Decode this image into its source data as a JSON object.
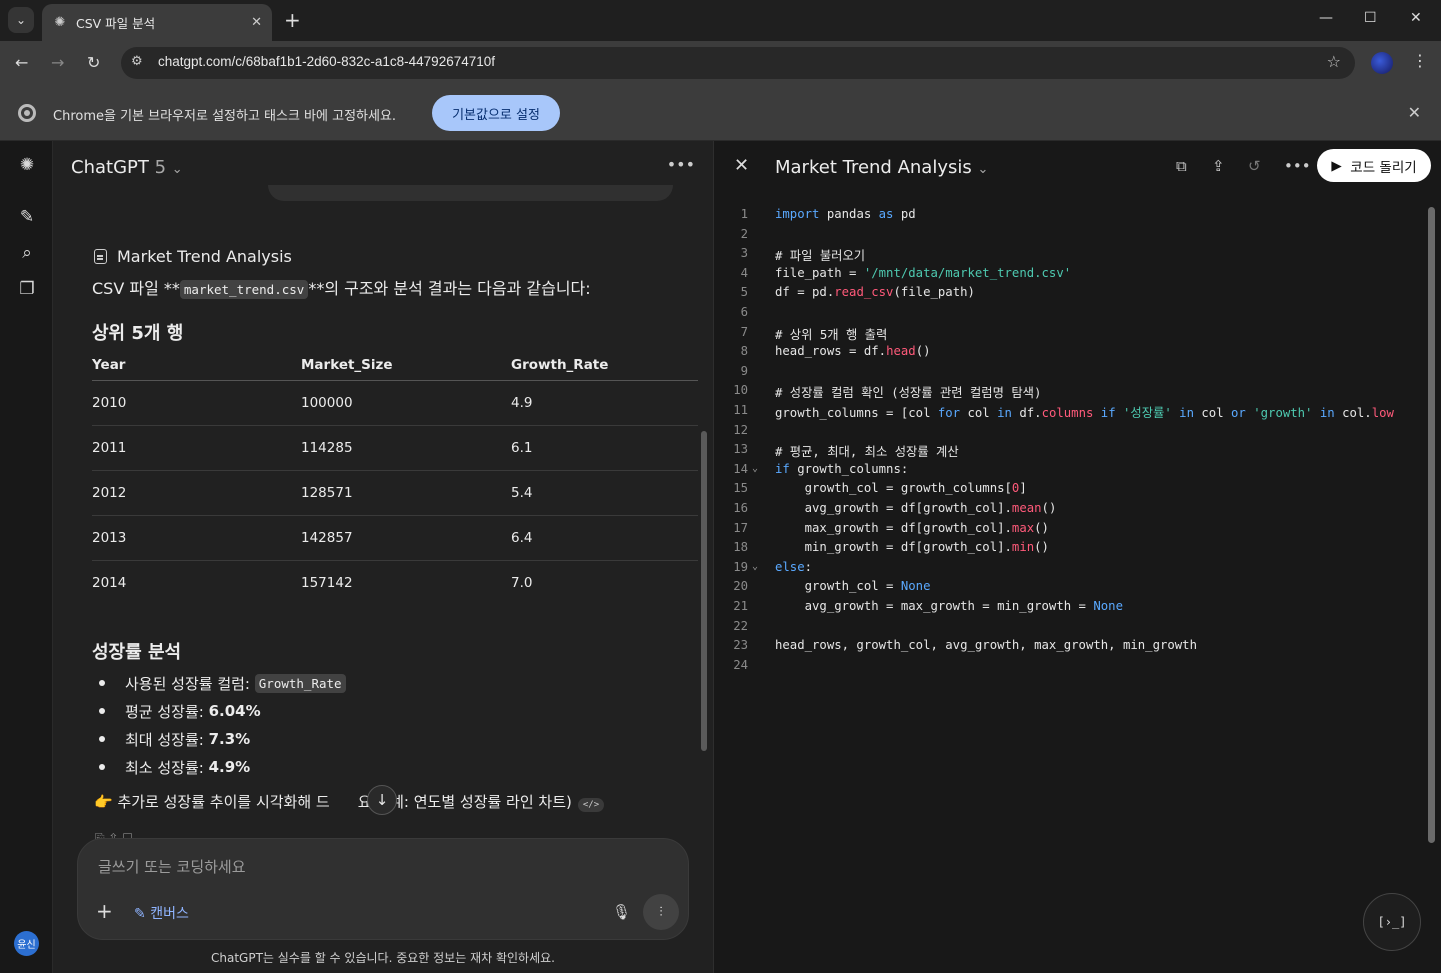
{
  "browser": {
    "tab_title": "CSV 파일 분석",
    "url": "chatgpt.com/c/68baf1b1-2d60-832c-a1c8-44792674710f",
    "infobar_message": "Chrome을 기본 브라우저로 설정하고 태스크 바에 고정하세요.",
    "infobar_button": "기본값으로 설정"
  },
  "chat": {
    "model_name": "ChatGPT",
    "model_version": "5",
    "doc_reference": "Market Trend Analysis",
    "intro_prefix": "CSV 파일 **",
    "intro_code": "market_trend.csv",
    "intro_suffix": "**의 구조와 분석 결과는 다음과 같습니다:",
    "section1_title": "상위 5개 행",
    "table": {
      "headers": [
        "Year",
        "Market_Size",
        "Growth_Rate"
      ],
      "rows": [
        [
          "2010",
          "100000",
          "4.9"
        ],
        [
          "2011",
          "114285",
          "6.1"
        ],
        [
          "2012",
          "128571",
          "5.4"
        ],
        [
          "2013",
          "142857",
          "6.4"
        ],
        [
          "2014",
          "157142",
          "7.0"
        ]
      ]
    },
    "section2_title": "성장률 분석",
    "stats": {
      "column_label": "사용된 성장률 컬럼:",
      "column_value": "Growth_Rate",
      "avg_label": "평균 성장률:",
      "avg_value": "6.04%",
      "max_label": "최대 성장률:",
      "max_value": "7.3%",
      "min_label": "최소 성장률:",
      "min_value": "4.9%"
    },
    "followup_left": "👉 추가로 성장률 추이를 시각화해 드",
    "followup_right": "요? (예: 연도별 성장률 라인 차트)",
    "composer_placeholder": "글쓰기 또는 코딩하세요",
    "canvas_label": "캔버스",
    "disclaimer": "ChatGPT는 실수를 할 수 있습니다. 중요한 정보는 재차 확인하세요.",
    "user_avatar": "윤신"
  },
  "canvas": {
    "title": "Market Trend Analysis",
    "run_label": "코드 돌리기",
    "console_icon": "[›_]"
  }
}
